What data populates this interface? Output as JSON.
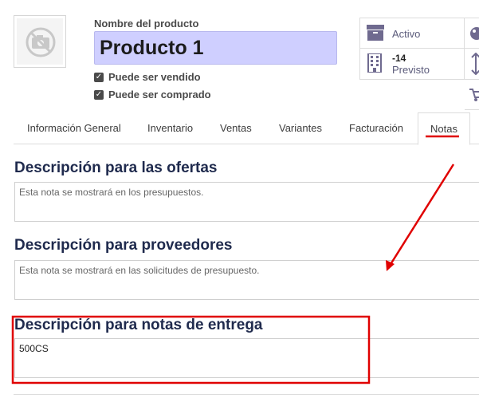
{
  "product": {
    "name_label": "Nombre del producto",
    "name_value": "Producto 1",
    "can_be_sold_label": "Puede ser vendido",
    "can_be_sold_checked": true,
    "can_be_purchased_label": "Puede ser comprado",
    "can_be_purchased_checked": true,
    "image_icon": "no-camera-icon"
  },
  "smart_buttons": {
    "active_label": "Activo",
    "active_icon": "archive-icon",
    "forecast_value": "-14",
    "forecast_label": "Previsto",
    "forecast_icon": "building-icon",
    "extra_icons": [
      "tag-icon",
      "swap-vertical-icon",
      "cart-icon"
    ]
  },
  "tabs": [
    {
      "label": "Información General",
      "active": false
    },
    {
      "label": "Inventario",
      "active": false
    },
    {
      "label": "Ventas",
      "active": false
    },
    {
      "label": "Variantes",
      "active": false
    },
    {
      "label": "Facturación",
      "active": false
    },
    {
      "label": "Notas",
      "active": true
    }
  ],
  "notes": {
    "sales_title": "Descripción para las ofertas",
    "sales_placeholder": "Esta nota se mostrará en los presupuestos.",
    "purchase_title": "Descripción para proveedores",
    "purchase_placeholder": "Esta nota se mostrará en las solicitudes de presupuesto.",
    "delivery_title": "Descripción para notas de entrega",
    "delivery_value": "500CS"
  },
  "colors": {
    "name_field_bg": "#cfcfff",
    "accent": "#7c6f9f",
    "annotation_red": "#e00000",
    "section_title": "#1f2a4d"
  }
}
